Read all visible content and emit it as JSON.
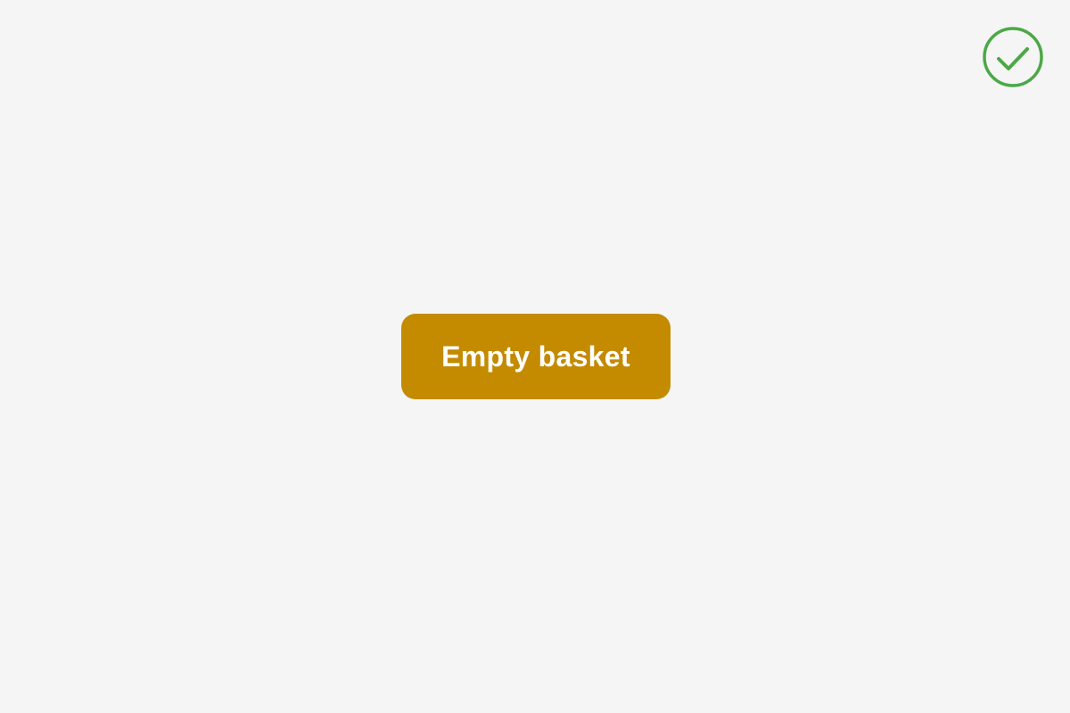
{
  "status": {
    "icon": "check-circle-icon",
    "color": "#4ca846"
  },
  "main": {
    "empty_basket_label": "Empty basket",
    "button_color": "#c48a00",
    "button_text_color": "#ffffff"
  },
  "background_color": "#f5f5f5"
}
